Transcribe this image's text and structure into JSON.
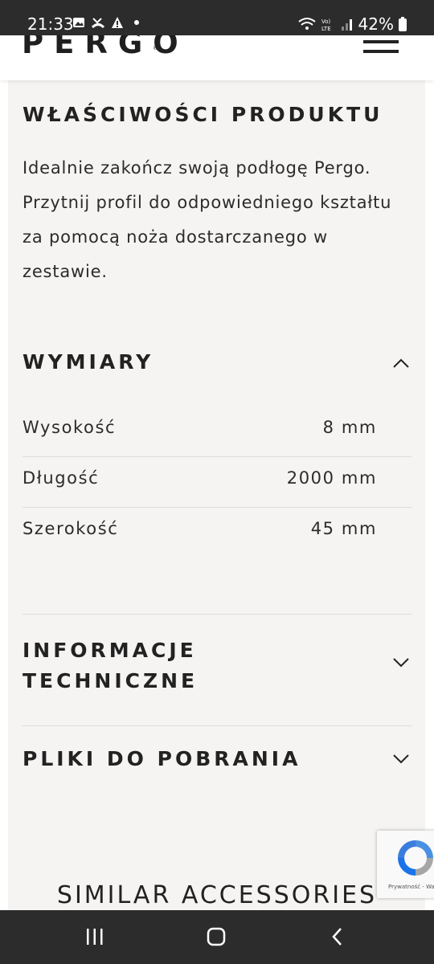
{
  "status_bar": {
    "time": "21:33",
    "battery": "42%",
    "icons": [
      "image-icon",
      "missed-call-icon",
      "warning-icon",
      "dot-icon"
    ],
    "right_icons": [
      "wifi-calling-icon",
      "volte-icon",
      "signal-icon",
      "battery-icon"
    ]
  },
  "header": {
    "logo": "PERGO",
    "logo_mark": "®",
    "menu_icon": "hamburger-menu-icon"
  },
  "product": {
    "properties_title": "WŁAŚCIWOŚCI PRODUKTU",
    "properties_text": "Idealnie zakończ swoją podłogę Pergo. Przytnij profil do odpowiedniego kształtu za pomocą noża dostarczanego w zestawie."
  },
  "dimensions": {
    "title": "WYMIARY",
    "expanded": true,
    "rows": [
      {
        "label": "Wysokość",
        "value": "8 mm"
      },
      {
        "label": "Długość",
        "value": "2000 mm"
      },
      {
        "label": "Szerokość",
        "value": "45 mm"
      }
    ]
  },
  "sections": {
    "technical": {
      "line1": "INFORMACJE",
      "line2": "TECHNICZNE",
      "expanded": false
    },
    "downloads": {
      "title": "PLIKI DO POBRANIA",
      "expanded": false
    }
  },
  "similar_title": "SIMILAR ACCESSORIES",
  "recaptcha": {
    "text": "Prywatność - Warunki"
  },
  "nav_bar": {
    "icons": [
      "recent-apps-icon",
      "home-icon",
      "back-icon"
    ]
  },
  "colors": {
    "panel_bg": "#f5f4f2",
    "text": "#1c1c1c",
    "system_bar": "#2c2c2c"
  }
}
